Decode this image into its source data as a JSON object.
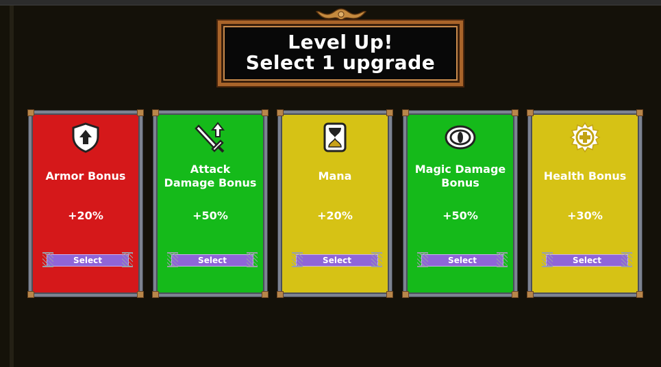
{
  "title": {
    "line1": "Level Up!",
    "line2": "Select 1 upgrade"
  },
  "colors": {
    "red": "#d5181a",
    "green": "#15ba1a",
    "yellow": "#d6c215",
    "button": "#8f65d8",
    "frame_gold": "#a9642a"
  },
  "cards": [
    {
      "title": "Armor Bonus",
      "value": "+20%",
      "icon": "shield-arrow-icon",
      "color": "#d5181a",
      "button": "Select"
    },
    {
      "title": "Attack\nDamage Bonus",
      "value": "+50%",
      "icon": "sword-arrow-icon",
      "color": "#15ba1a",
      "button": "Select"
    },
    {
      "title": "Mana",
      "value": "+20%",
      "icon": "hourglass-icon",
      "color": "#d6c215",
      "button": "Select"
    },
    {
      "title": "Magic Damage\nBonus",
      "value": "+50%",
      "icon": "eye-icon",
      "color": "#15ba1a",
      "button": "Select"
    },
    {
      "title": "Health Bonus",
      "value": "+30%",
      "icon": "health-plus-icon",
      "color": "#d6c215",
      "button": "Select"
    }
  ]
}
